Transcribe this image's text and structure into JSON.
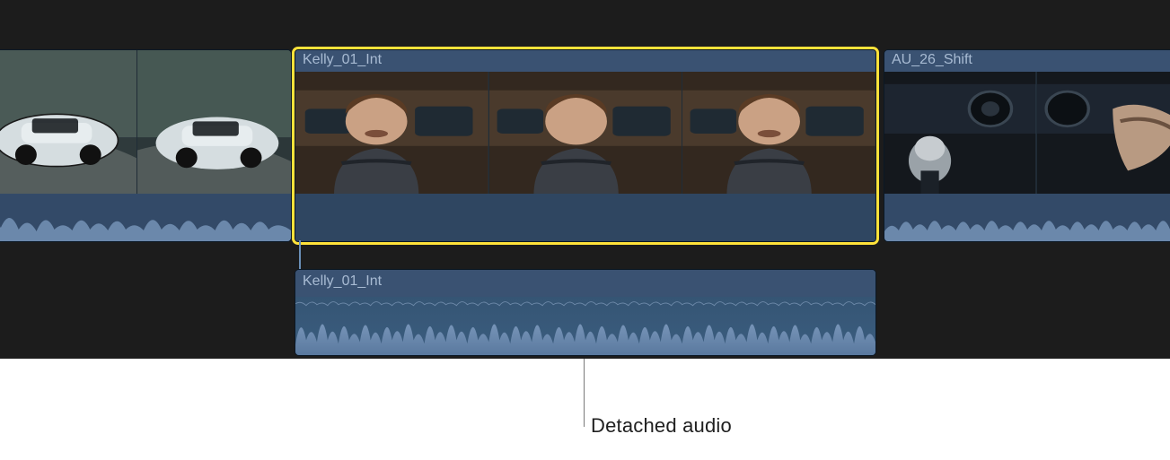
{
  "clips": {
    "clip1": {
      "name": ""
    },
    "clip2": {
      "name": "Kelly_01_Int",
      "selected": true
    },
    "clip3": {
      "name": "AU_26_Shift"
    }
  },
  "detached_audio": {
    "name": "Kelly_01_Int"
  },
  "callout": {
    "label": "Detached audio"
  },
  "colors": {
    "selection": "#ffe23a",
    "clip_bg": "#2d4664",
    "clip_header": "#3a5272",
    "clip_text": "#a8bbd3",
    "timeline_bg": "#1c1c1c"
  }
}
